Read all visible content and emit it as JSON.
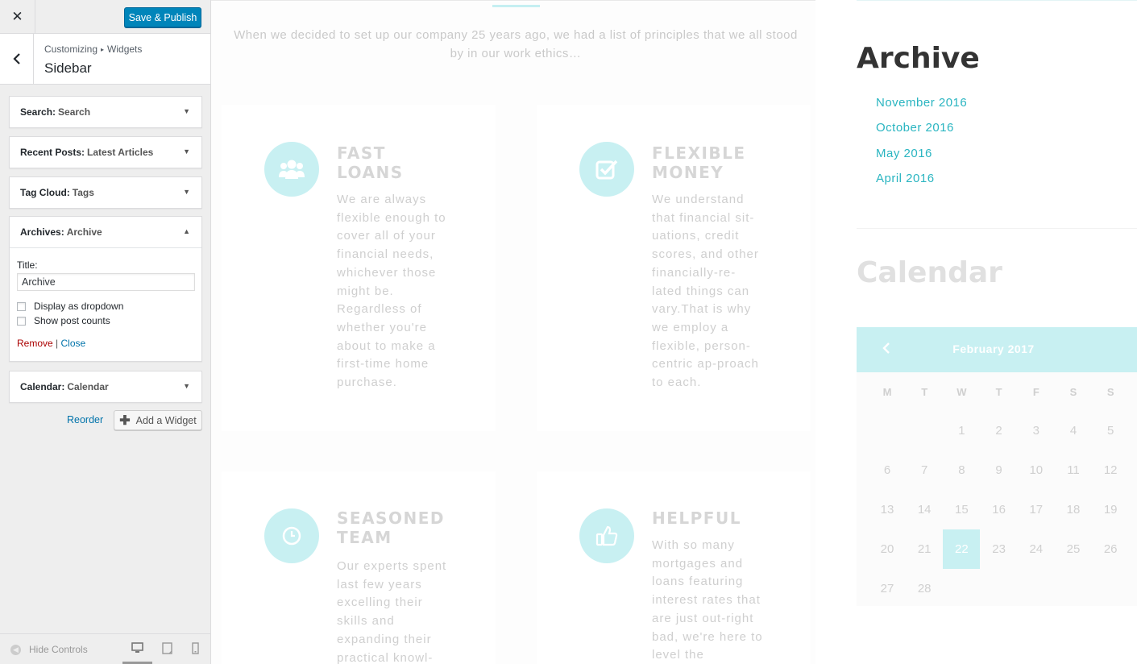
{
  "customizer": {
    "close_icon": "close-icon",
    "publish_label": "Save & Publish",
    "back_icon": "chevron-left-icon",
    "breadcrumb": {
      "first": "Customizing",
      "second": "Widgets"
    },
    "section_title": "Sidebar",
    "widgets": [
      {
        "type": "Search:",
        "title": "Search",
        "expanded": false
      },
      {
        "type": "Recent Posts:",
        "title": "Latest Articles",
        "expanded": false
      },
      {
        "type": "Tag Cloud:",
        "title": "Tags",
        "expanded": false
      },
      {
        "type": "Archives:",
        "title": "Archive",
        "expanded": true
      },
      {
        "type": "Calendar:",
        "title": "Calendar",
        "expanded": false
      }
    ],
    "archive_form": {
      "title_label": "Title:",
      "title_value": "Archive",
      "dropdown_label": "Display as dropdown",
      "dropdown_checked": false,
      "counts_label": "Show post counts",
      "counts_checked": false,
      "remove_label": "Remove",
      "separator": "|",
      "close_label": "Close"
    },
    "reorder_label": "Reorder",
    "add_widget_label": "Add a Widget",
    "hide_controls_label": "Hide Controls",
    "devices": [
      "desktop-icon",
      "tablet-icon",
      "mobile-icon"
    ],
    "active_device": "desktop"
  },
  "preview": {
    "intro_text": "When we decided to set up our company 25 years ago, we had a list of principles that we all stood by in our work ethics…",
    "cards": [
      {
        "icon": "users-icon",
        "title_l1": "FAST",
        "title_l2": "LOANS",
        "text": "We are always flexible enough to cover all of your financial needs, whichever those might be. Regardless of whether you're about to make a first-time home purchase."
      },
      {
        "icon": "check-square-icon",
        "title_l1": "FLEXIBLE",
        "title_l2": "MONEY",
        "text": "We understand that financial sit-uations, credit scores, and other financially-re-lated things can vary.That is why we employ a flexible, person-centric ap-proach to each."
      },
      {
        "icon": "clock-icon",
        "title_l1": "SEASONED",
        "title_l2": "TEAM",
        "text": "Our experts spent last few years excelling their skills and expanding their practical knowl-"
      },
      {
        "icon": "thumbs-up-icon",
        "title_l1": "HELPFUL",
        "title_l2": "",
        "text": "With so many mortgages and loans featuring interest rates that are just out-right bad, we're here to level the"
      }
    ],
    "archive": {
      "title": "Archive",
      "items": [
        "November 2016",
        "October 2016",
        "May 2016",
        "April 2016"
      ],
      "link_color": "#2ab5c1"
    },
    "calendar": {
      "title": "Calendar",
      "month": "February 2017",
      "prev_icon": "chevron-left-icon",
      "weekdays": [
        "M",
        "T",
        "W",
        "T",
        "F",
        "S",
        "S"
      ],
      "weeks": [
        [
          "",
          "",
          "1",
          "2",
          "3",
          "4",
          "5"
        ],
        [
          "6",
          "7",
          "8",
          "9",
          "10",
          "11",
          "12"
        ],
        [
          "13",
          "14",
          "15",
          "16",
          "17",
          "18",
          "19"
        ],
        [
          "20",
          "21",
          "22",
          "23",
          "24",
          "25",
          "26"
        ],
        [
          "27",
          "28",
          "",
          "",
          "",
          "",
          ""
        ]
      ],
      "today": "22",
      "accent_color": "#c8f0f2"
    }
  }
}
